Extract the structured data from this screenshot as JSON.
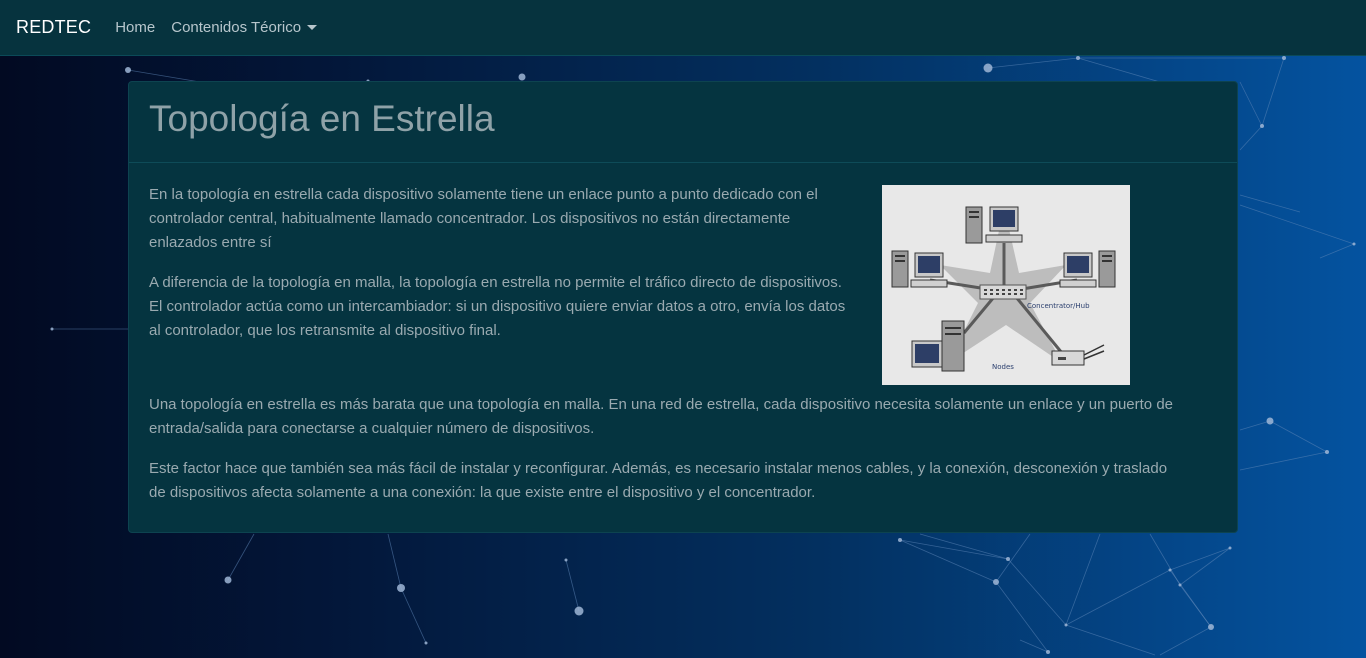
{
  "navbar": {
    "brand": "REDTEC",
    "links": [
      {
        "label": "Home"
      },
      {
        "label": "Contenidos Téorico",
        "dropdown": true
      }
    ]
  },
  "card": {
    "title": "Topología en Estrella",
    "paragraphs_top": [
      "En la topología en estrella cada dispositivo solamente tiene un enlace punto a punto dedicado con el controlador central, habitualmente llamado concentrador. Los dispositivos no están directamente enlazados entre sí",
      "A diferencia de la topología en malla, la topología en estrella no permite el tráfico directo de dispositivos. El controlador actúa como un intercambiador: si un dispositivo quiere enviar datos a otro, envía los datos al controlador, que los retransmite al dispositivo final."
    ],
    "paragraphs_bottom": [
      "Una topología en estrella es más barata que una topología en malla. En una red de estrella, cada dispositivo necesita solamente un enlace y un puerto de entrada/salida para conectarse a cualquier número de dispositivos.",
      "Este factor hace que también sea más fácil de instalar y reconfigurar. Además, es necesario instalar menos cables, y la conexión, desconexión y traslado de dispositivos afecta solamente a una conexión: la que existe entre el dispositivo y el concentrador."
    ],
    "diagram": {
      "hub_label": "Concentrator/Hub",
      "nodes_label": "Nodes"
    }
  },
  "colors": {
    "navbar_bg": "#06333e",
    "card_bg": "#053440",
    "text": "#9aaab0",
    "title": "#8fa2a8"
  }
}
